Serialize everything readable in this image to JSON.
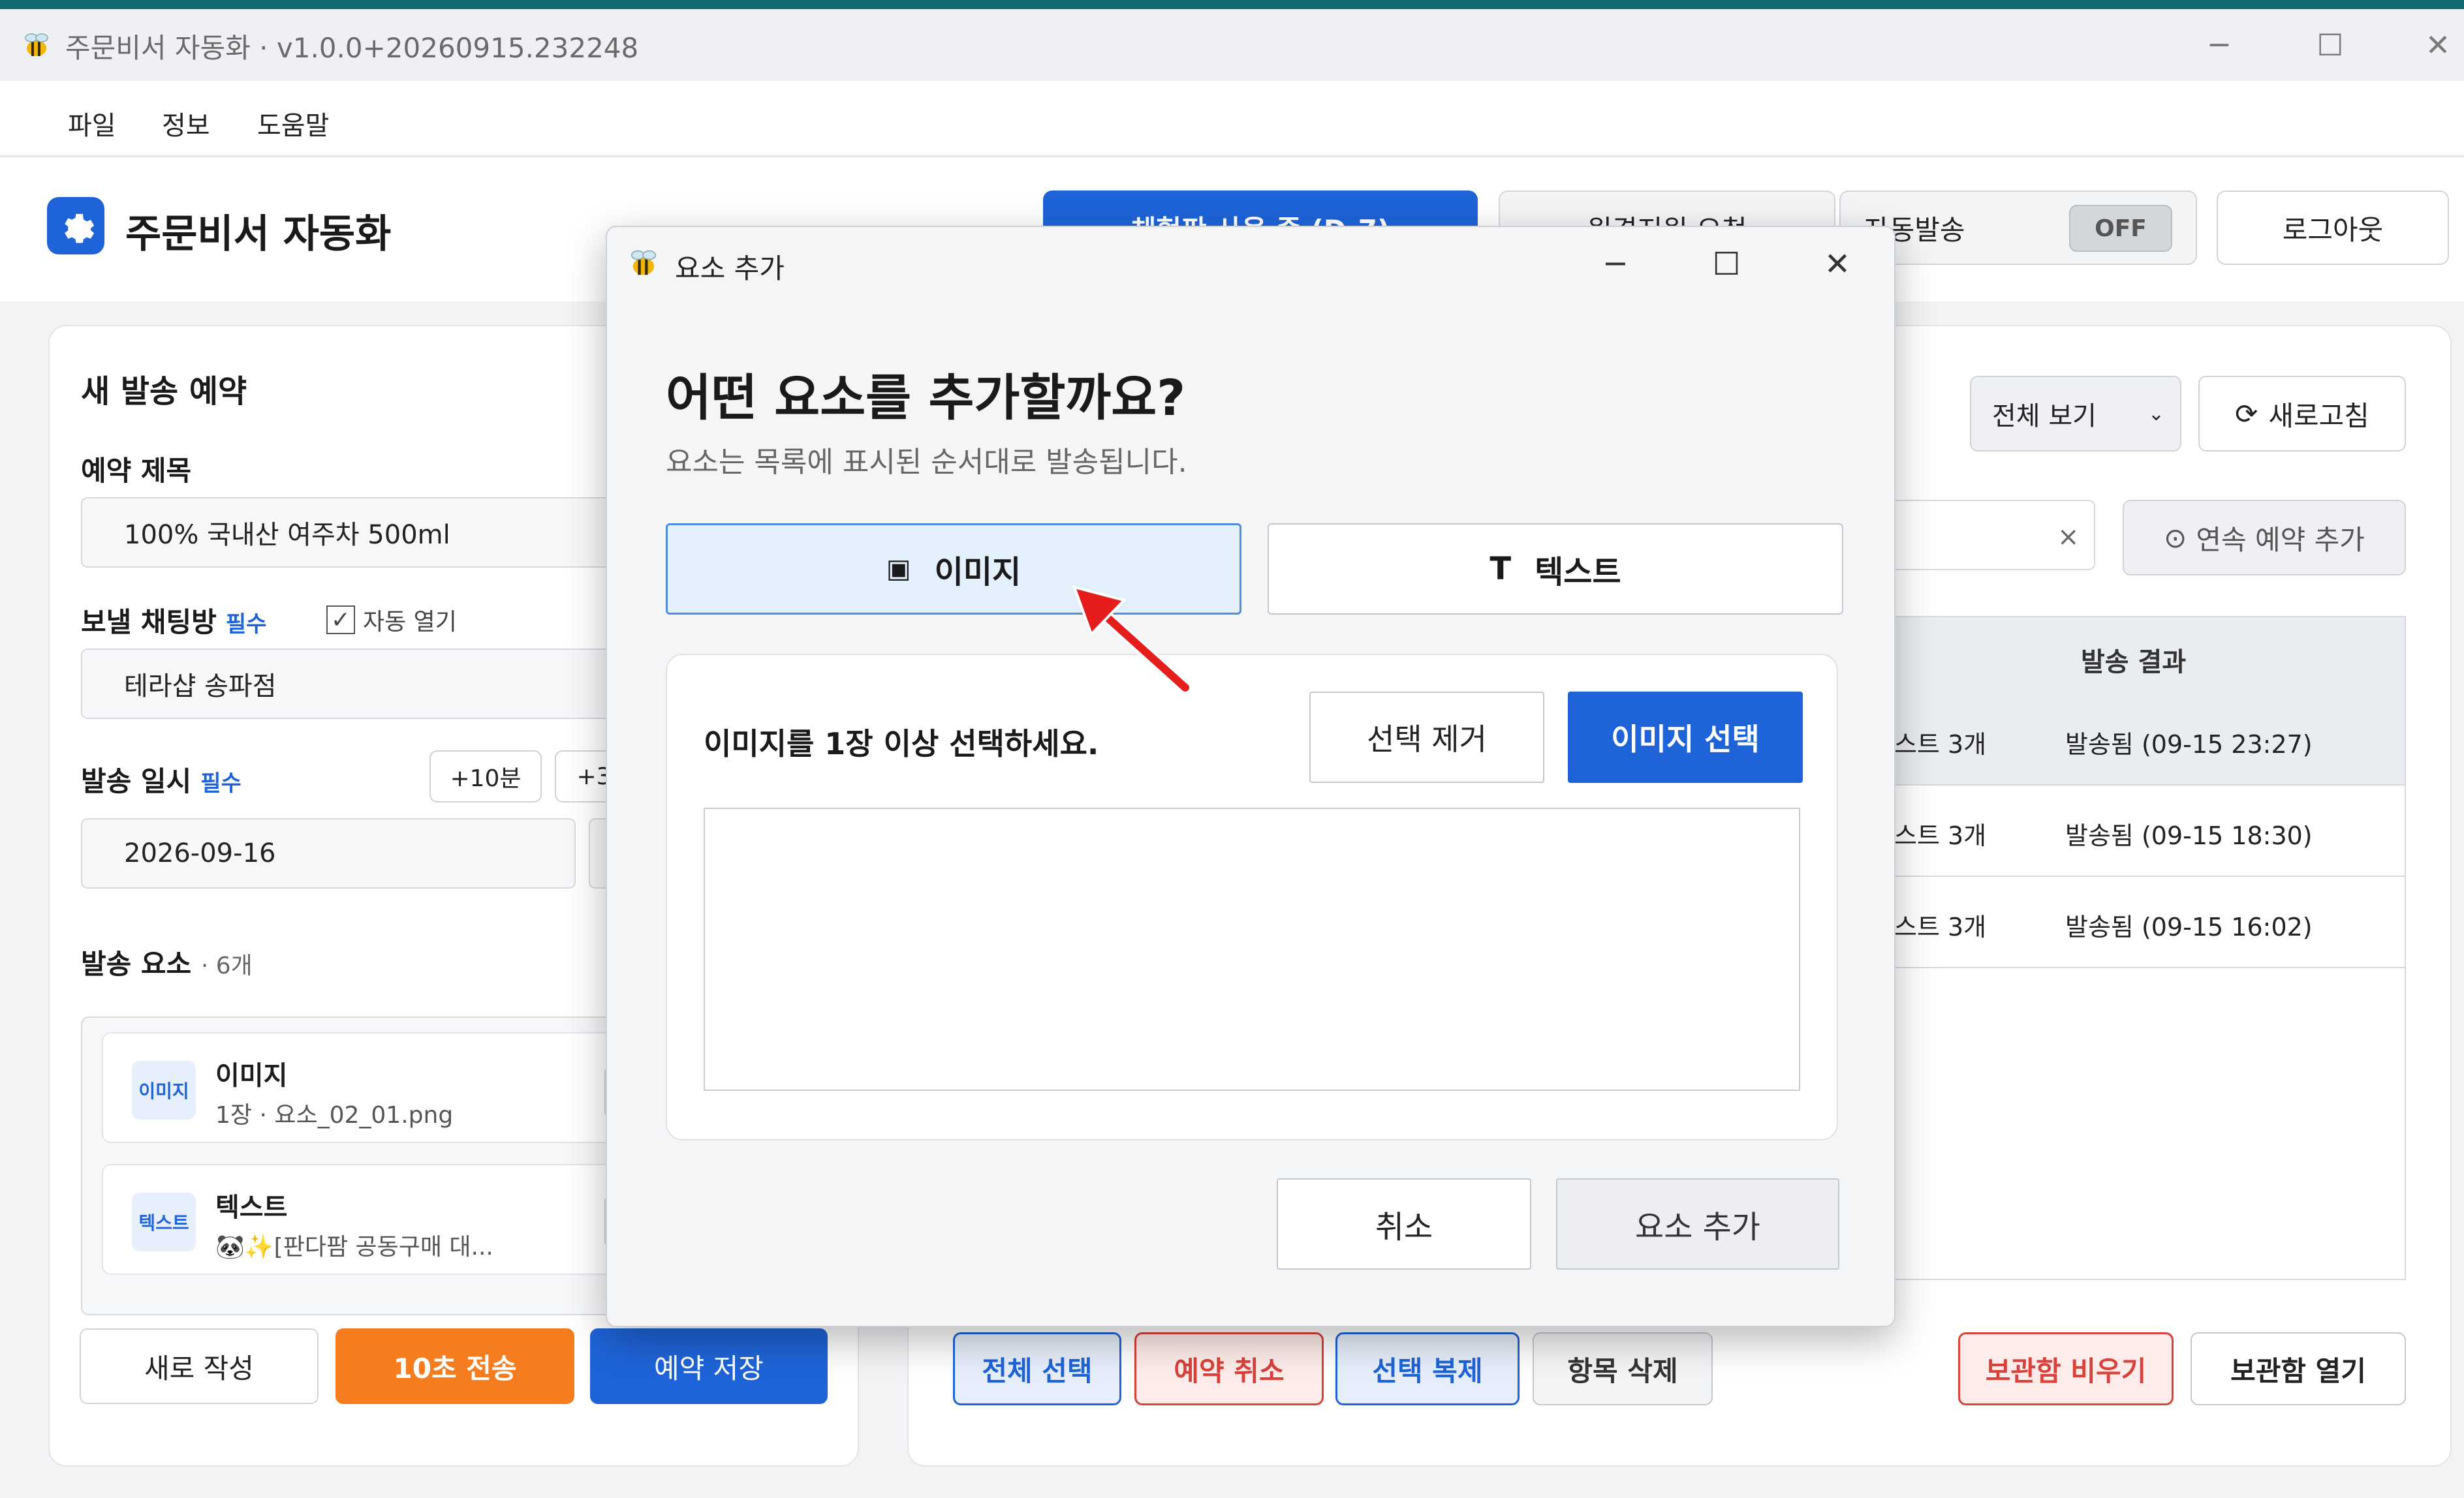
{
  "window": {
    "title": "주문비서 자동화 · v1.0.0+20260915.232248"
  },
  "menu": [
    "파일",
    "정보",
    "도움말"
  ],
  "header": {
    "brand": "주문비서 자동화",
    "trial_label": "체험판 사용 중 (D-7)",
    "remote_label": "원격지원 요청",
    "auto_send_label": "자동발송",
    "auto_send_state": "OFF",
    "logout_label": "로그아웃"
  },
  "left": {
    "section_title": "새 발송 예약",
    "title_label": "예약 제목",
    "title_value": "100% 국내산 여주차 500ml",
    "chat_label": "보낼 채팅방",
    "required": "필수",
    "auto_open": "자동 열기",
    "chat_value": "테라샵 송파점",
    "time_label": "발송 일시",
    "plus10": "+10분",
    "plus3_partial": "+3",
    "date_value": "2026-09-16",
    "elements_label": "발송 요소",
    "elements_count": "· 6개",
    "elements": [
      {
        "badge": "이미지",
        "title": "이미지",
        "sub": "1장 · 요소_02_01.png"
      },
      {
        "badge": "텍스트",
        "title": "텍스트",
        "sub": "🐼✨[판다팜 공동구매 대..."
      }
    ],
    "new_btn": "새로 작성",
    "send_btn": "10초 전송",
    "save_btn": "예약 저장"
  },
  "right": {
    "view_select": "전체 보기",
    "refresh": "새로고침",
    "clear_x": "×",
    "continuous_add": "연속 예약 추가",
    "col_result": "발송 결과",
    "rows": [
      {
        "items": "스트 3개",
        "result": "발송됨 (09-15 23:27)"
      },
      {
        "items": "스트 3개",
        "result": "발송됨 (09-15 18:30)"
      },
      {
        "items": "스트 3개",
        "result": "발송됨 (09-15 16:02)"
      }
    ],
    "select_all": "전체 선택",
    "cancel_reservation": "예약 취소",
    "duplicate": "선택 복제",
    "delete_item": "항목 삭제",
    "empty_archive": "보관함 비우기",
    "open_archive": "보관함 열기"
  },
  "dialog": {
    "title": "요소 추가",
    "heading": "어떤 요소를 추가할까요?",
    "subheading": "요소는 목록에 표시된 순서대로 발송됩니다.",
    "type_image": "이미지",
    "type_text": "텍스트",
    "text_icon_glyph": "T",
    "prompt": "이미지를 1장 이상 선택하세요.",
    "clear_selection": "선택 제거",
    "choose_image": "이미지 선택",
    "cancel": "취소",
    "add": "요소 추가"
  },
  "colors": {
    "accent": "#1e64d8",
    "orange": "#f57c1f",
    "danger": "#d9413a"
  }
}
